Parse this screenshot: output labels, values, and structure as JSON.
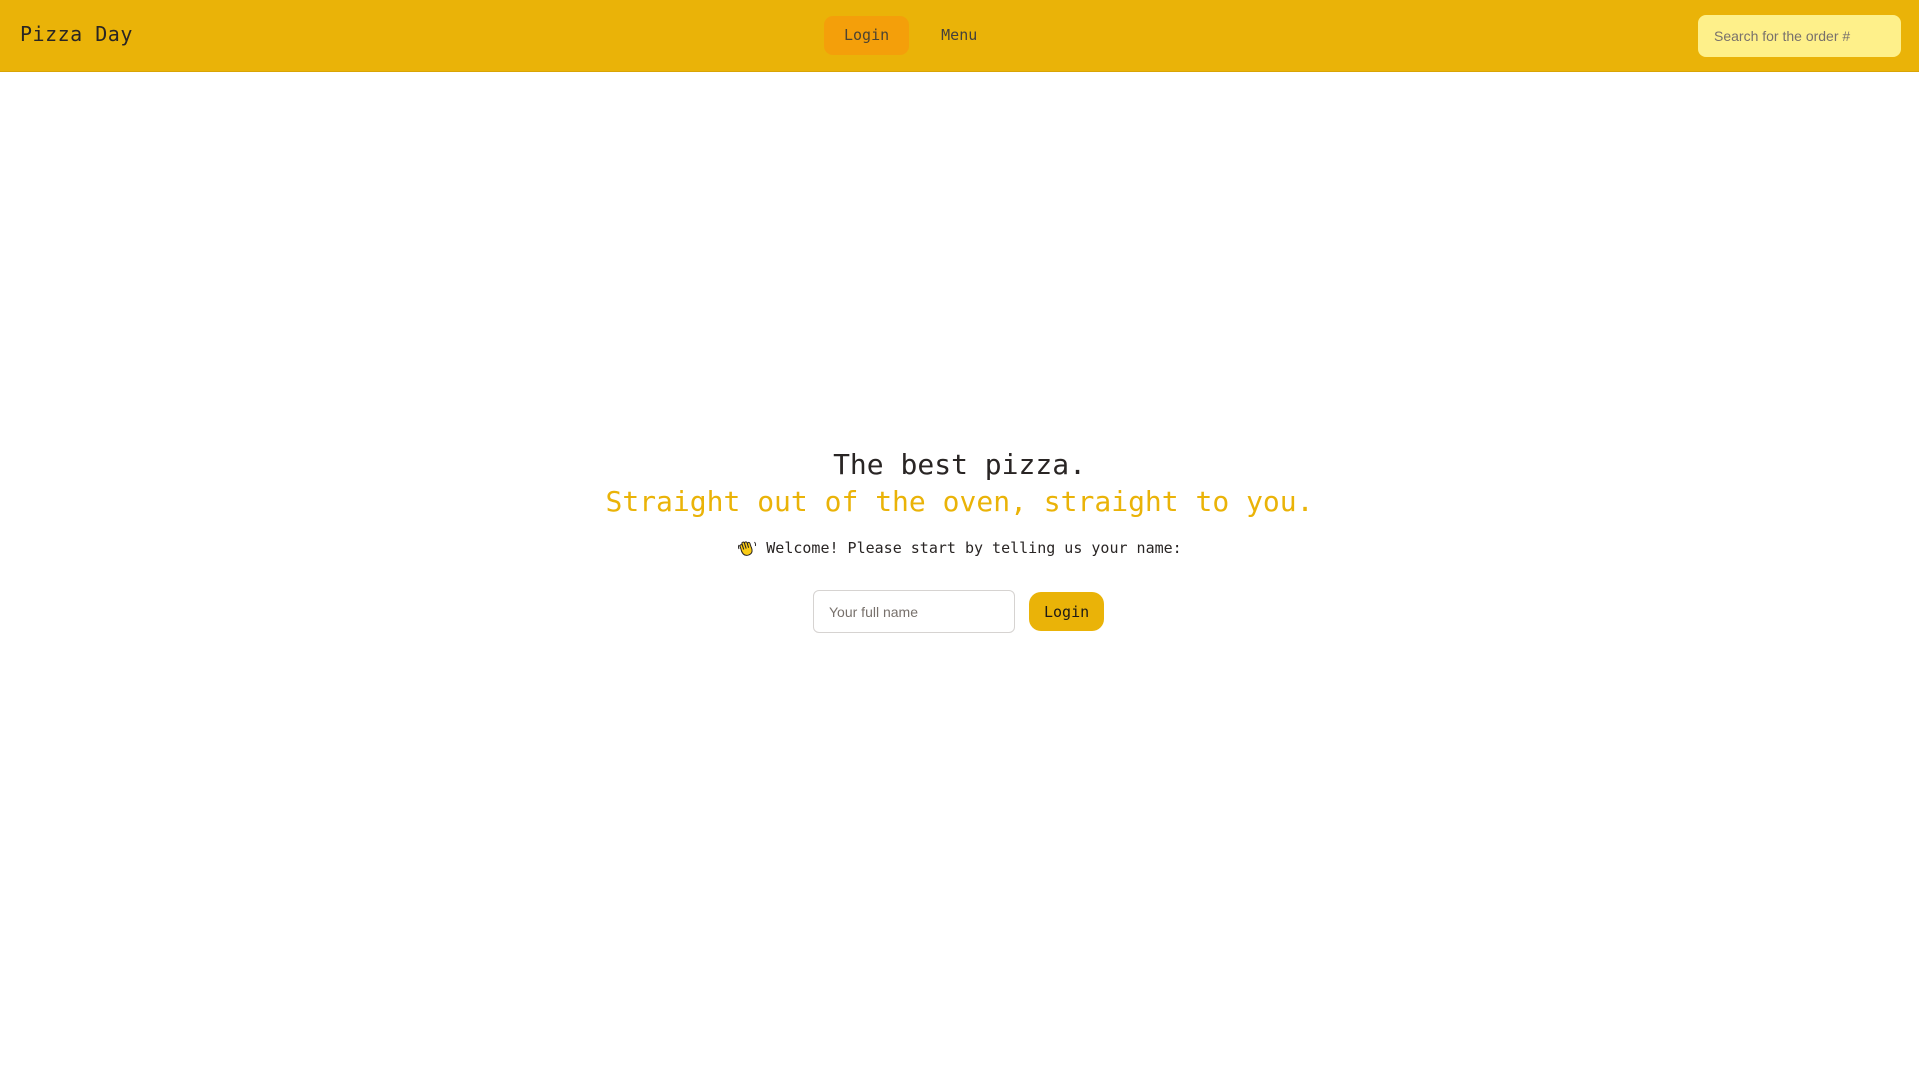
{
  "header": {
    "brand": "Pizza Day",
    "nav": [
      {
        "label": "Login",
        "active": true
      },
      {
        "label": "Menu",
        "active": false
      }
    ],
    "search": {
      "placeholder": "Search for the order #",
      "value": ""
    }
  },
  "hero": {
    "title": "The best pizza.",
    "subtitle": "Straight out of the oven, straight to you.",
    "welcome_text": "Welcome! Please start by telling us your name:",
    "welcome_icon": "waving-hand-icon"
  },
  "login_form": {
    "name_placeholder": "Your full name",
    "name_value": "",
    "button_label": "Login"
  },
  "colors": {
    "brand_yellow": "#eab308",
    "active_nav": "#f59e0b",
    "search_bg": "#fef08a",
    "text_dark": "#292524"
  }
}
